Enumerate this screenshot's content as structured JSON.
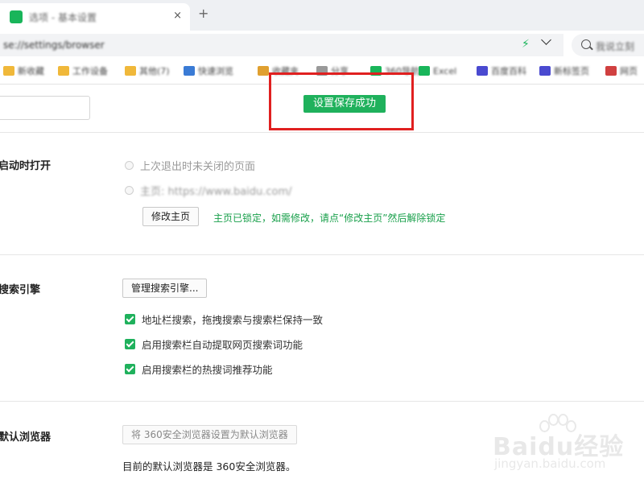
{
  "tab": {
    "title": "选项 - 基本设置",
    "close": "×",
    "new_tab": "+"
  },
  "address": {
    "url": "se://settings/browser",
    "search_placeholder": "我说立刻"
  },
  "bookmarks": [
    {
      "label": "新收藏",
      "color": "#f0b83a"
    },
    {
      "label": "工作设备",
      "color": "#f0b83a"
    },
    {
      "label": "其他(7)",
      "color": "#f0b83a"
    },
    {
      "label": "快速浏览",
      "color": "#3a7bd5"
    },
    {
      "label": "收藏夹",
      "color": "#e0a030"
    },
    {
      "label": "分享",
      "color": "#999999"
    },
    {
      "label": "360导航",
      "color": "#19b55a"
    },
    {
      "label": "Excel",
      "color": "#19b55a"
    },
    {
      "label": "百度百科",
      "color": "#4a4ad0"
    },
    {
      "label": "新标签页",
      "color": "#4a4ad0"
    },
    {
      "label": "网页",
      "color": "#d04040"
    }
  ],
  "toast": {
    "text": "设置保存成功"
  },
  "startup": {
    "title": "启动时打开",
    "option_last": "上次退出时未关闭的页面",
    "option_home": "主页: https://www.baidu.com/",
    "modify_home_button": "修改主页",
    "lock_note": "主页已锁定，如需修改，请点“修改主页”然后解除锁定"
  },
  "search_engine": {
    "title": "搜索引擎",
    "manage_button": "管理搜索引擎...",
    "options": [
      "地址栏搜索，拖拽搜索与搜索栏保持一致",
      "启用搜索栏自动提取网页搜索词功能",
      "启用搜索栏的热搜词推荐功能"
    ]
  },
  "default_browser": {
    "title": "默认浏览器",
    "set_default_button": "将 360安全浏览器设置为默认浏览器",
    "current_note": "目前的默认浏览器是 360安全浏览器。"
  },
  "watermark": {
    "logo": "Baidu经验",
    "url": "jingyan.baidu.com"
  }
}
